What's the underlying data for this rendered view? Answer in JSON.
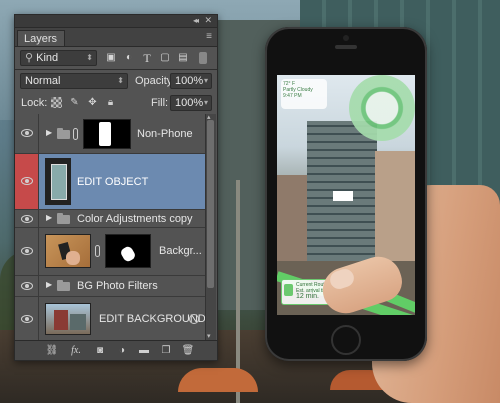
{
  "panel": {
    "tab_label": "Layers",
    "collapse_icon": "double-chevron-left-icon",
    "close_icon": "close-icon",
    "menu_icon": "panel-menu-icon"
  },
  "filter": {
    "kind_label": "Kind",
    "icons": [
      "pixel-filter-icon",
      "adjustment-filter-icon",
      "type-filter-icon",
      "shape-filter-icon",
      "smart-object-filter-icon",
      "filter-toggle-icon"
    ]
  },
  "blend": {
    "mode": "Normal",
    "opacity_label": "Opacity:",
    "opacity_value": "100%"
  },
  "lock": {
    "label": "Lock:",
    "icons": [
      "lock-transparent-icon",
      "lock-pixels-icon",
      "lock-position-icon",
      "lock-all-icon"
    ],
    "fill_label": "Fill:",
    "fill_value": "100%"
  },
  "layers": [
    {
      "name": "Non-Phone",
      "type": "group-masked",
      "visible": true,
      "selected": false
    },
    {
      "name": "EDIT OBJECT",
      "type": "smart-object",
      "visible": true,
      "selected": true
    },
    {
      "name": "Color Adjustments copy",
      "type": "group",
      "visible": true,
      "selected": false
    },
    {
      "name": "Backgr...",
      "type": "layer-masked",
      "visible": true,
      "selected": false
    },
    {
      "name": "BG Photo Filters",
      "type": "group",
      "visible": true,
      "selected": false
    },
    {
      "name": "EDIT BACKGROUND",
      "type": "smart-object",
      "visible": true,
      "selected": false
    }
  ],
  "bottom_icons": [
    "link-layers-icon",
    "fx-icon",
    "add-mask-icon",
    "adjustment-layer-icon",
    "new-group-icon",
    "new-layer-icon",
    "trash-icon"
  ],
  "bottom_fx_label": "fx.",
  "phone_screen": {
    "weather_temp": "72° F",
    "weather_desc": "Partly Cloudy",
    "weather_time": "9:47 PM",
    "route_title": "Current Route",
    "route_sub": "Est. arrival time",
    "route_time": "12 min."
  }
}
